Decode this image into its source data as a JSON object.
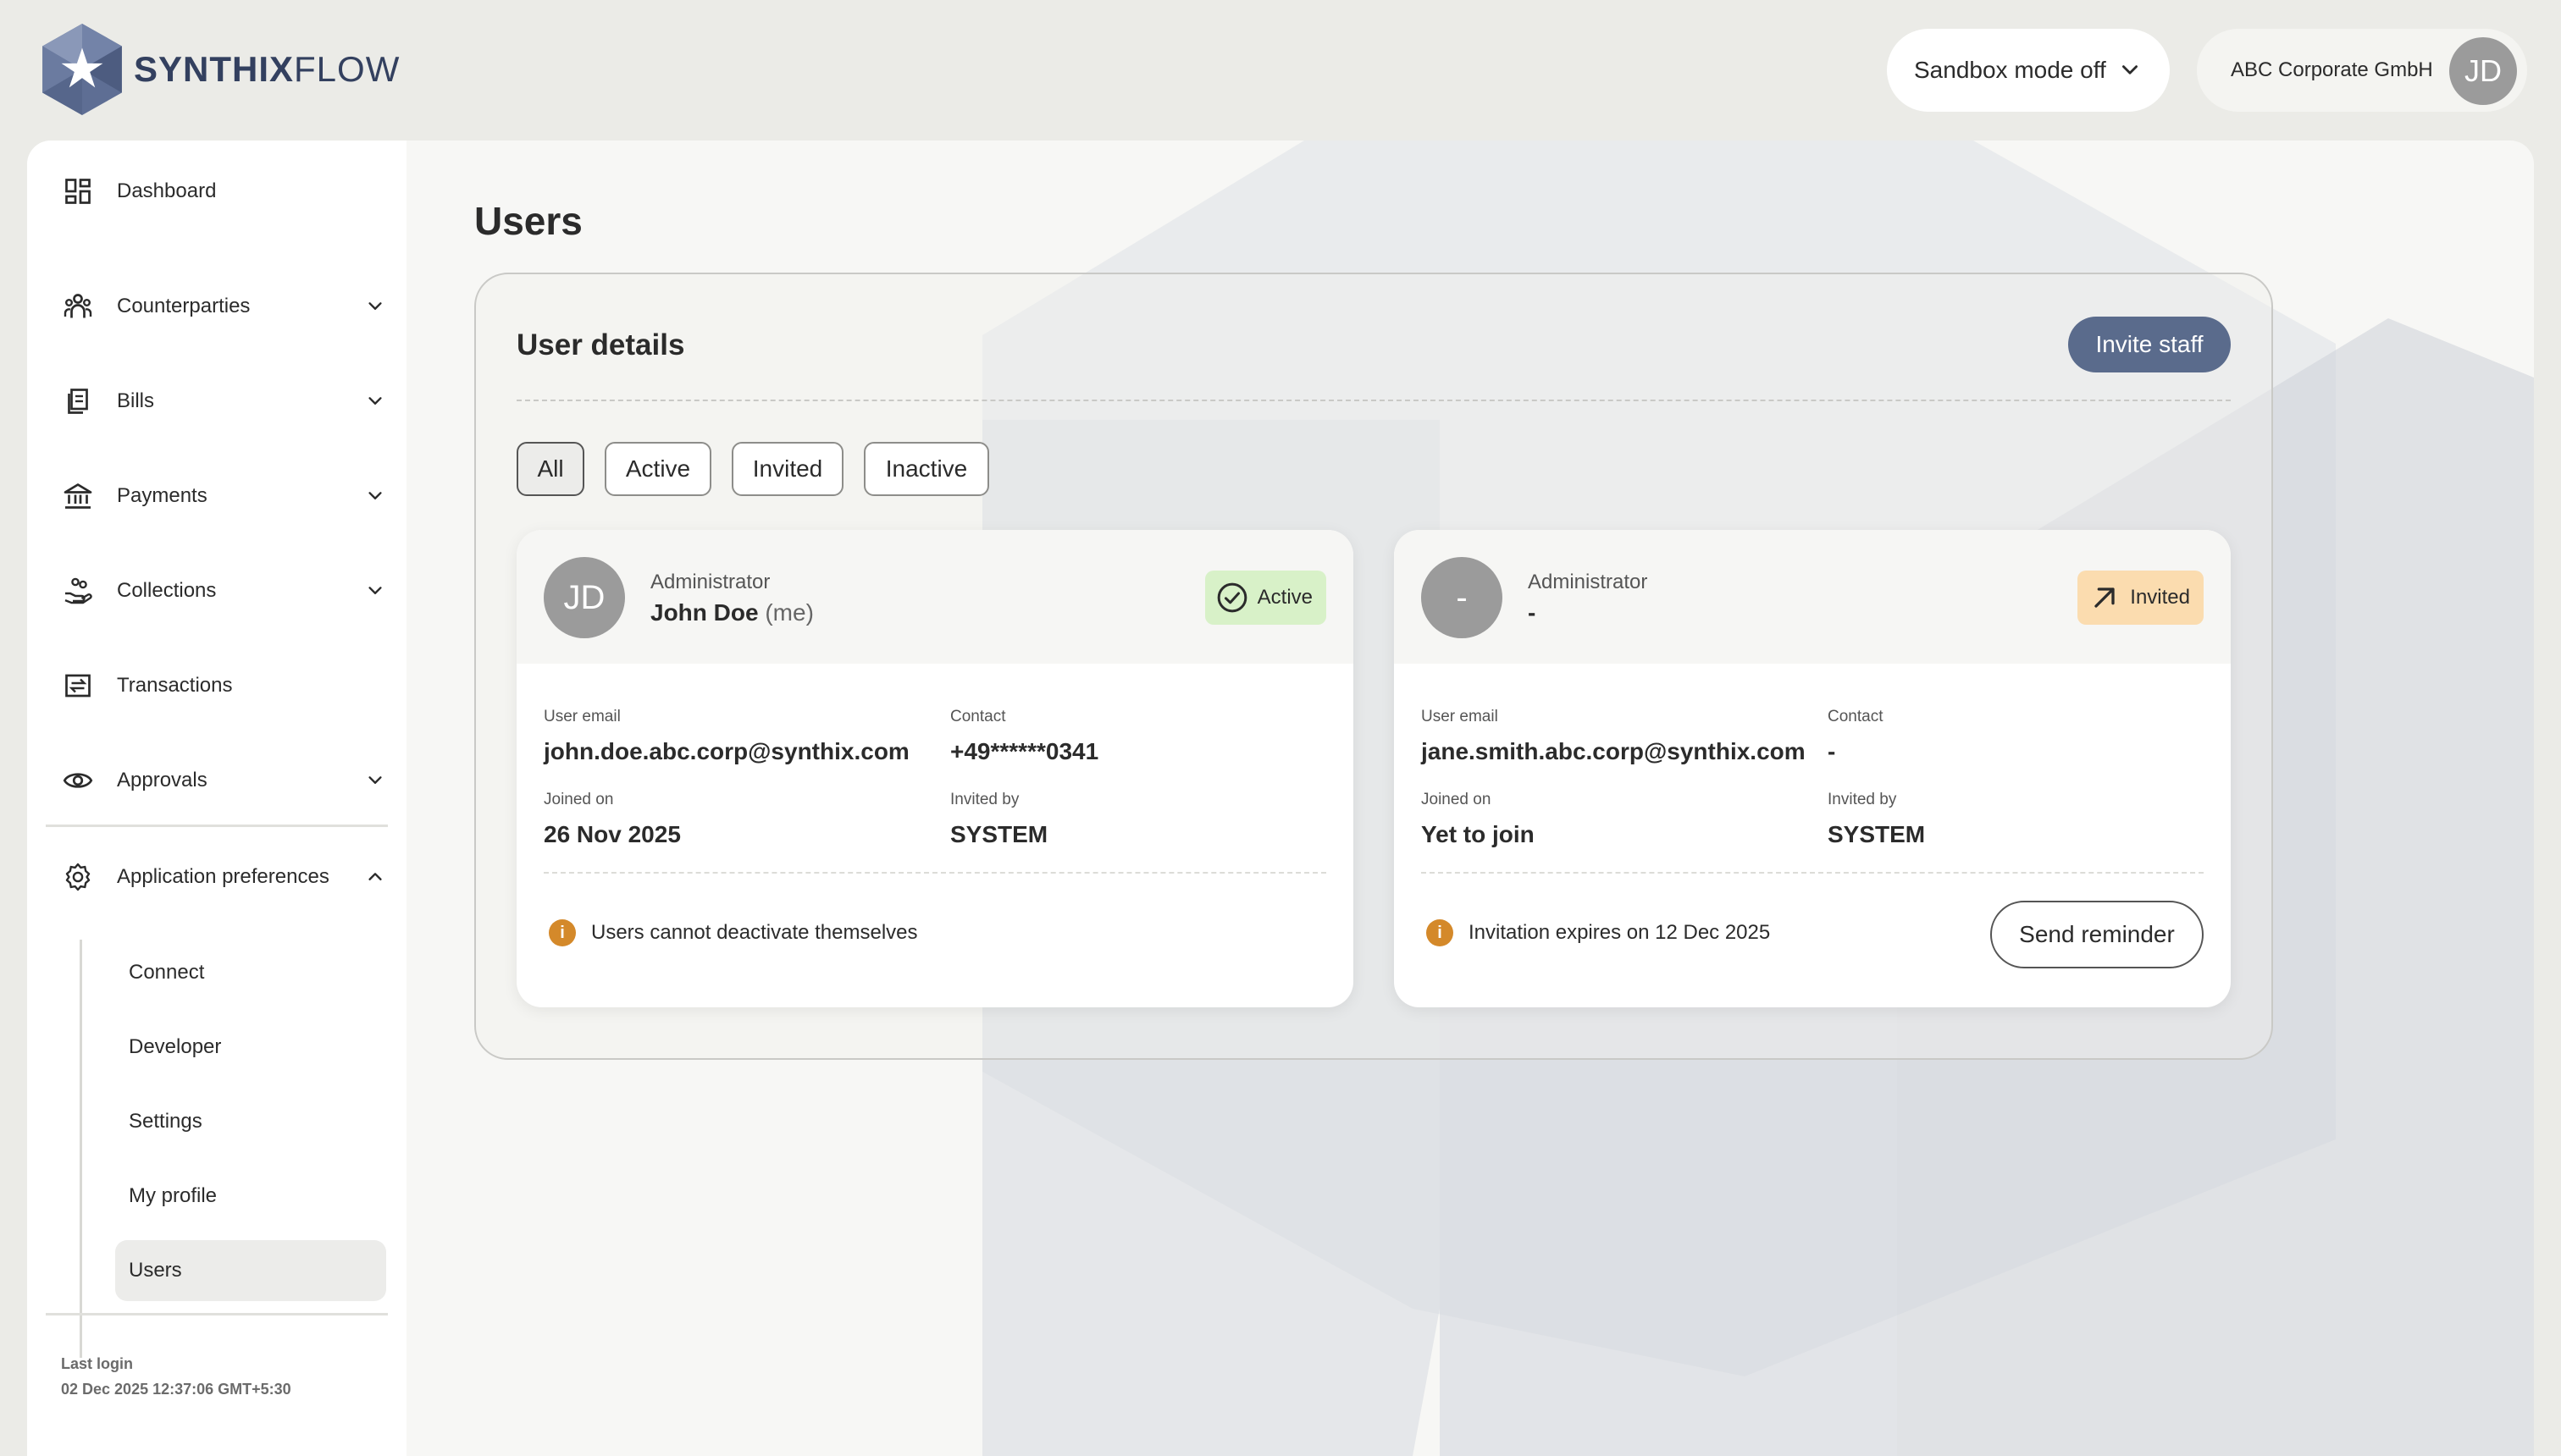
{
  "brand": {
    "name_bold": "SYNTHIX",
    "name_light": "FLOW"
  },
  "header": {
    "sandbox_label": "Sandbox mode off",
    "org_name": "ABC Corporate GmbH",
    "avatar_initials": "JD"
  },
  "sidebar": {
    "items": [
      {
        "label": "Dashboard",
        "icon": "dashboard-icon"
      },
      {
        "label": "Counterparties",
        "icon": "people-icon"
      },
      {
        "label": "Bills",
        "icon": "bills-icon"
      },
      {
        "label": "Payments",
        "icon": "bank-icon"
      },
      {
        "label": "Collections",
        "icon": "collections-icon"
      },
      {
        "label": "Transactions",
        "icon": "transactions-icon"
      },
      {
        "label": "Approvals",
        "icon": "eye-icon"
      },
      {
        "label": "Application preferences",
        "icon": "gear-icon"
      }
    ],
    "sub_items": [
      {
        "label": "Connect"
      },
      {
        "label": "Developer"
      },
      {
        "label": "Settings"
      },
      {
        "label": "My profile"
      },
      {
        "label": "Users",
        "active": true
      }
    ],
    "last_login_label": "Last login",
    "last_login_value": "02 Dec 2025 12:37:06 GMT+5:30"
  },
  "main": {
    "page_title": "Users",
    "panel_title": "User details",
    "invite_label": "Invite staff",
    "filters": [
      "All",
      "Active",
      "Invited",
      "Inactive"
    ],
    "selected_filter": "All",
    "labels": {
      "email": "User email",
      "contact": "Contact",
      "joined": "Joined on",
      "invited_by": "Invited by"
    },
    "users": [
      {
        "initials": "JD",
        "role": "Administrator",
        "name": "John Doe",
        "suffix": "(me)",
        "status": "Active",
        "email": "john.doe.abc.corp@synthix.com",
        "contact": "+49******0341",
        "joined": "26 Nov 2025",
        "invited_by": "SYSTEM",
        "note": "Users cannot deactivate themselves"
      },
      {
        "initials": "-",
        "role": "Administrator",
        "name": "-",
        "suffix": "",
        "status": "Invited",
        "email": "jane.smith.abc.corp@synthix.com",
        "contact": "-",
        "joined": "Yet to join",
        "invited_by": "SYSTEM",
        "note": "Invitation expires on 12 Dec 2025",
        "action_label": "Send reminder"
      }
    ]
  },
  "colors": {
    "brand_navy": "#33405f",
    "invite_button": "#5a6b8c",
    "active_badge": "#d8f1c8",
    "invited_badge": "#fbdcaf",
    "info_icon": "#d4892a"
  }
}
